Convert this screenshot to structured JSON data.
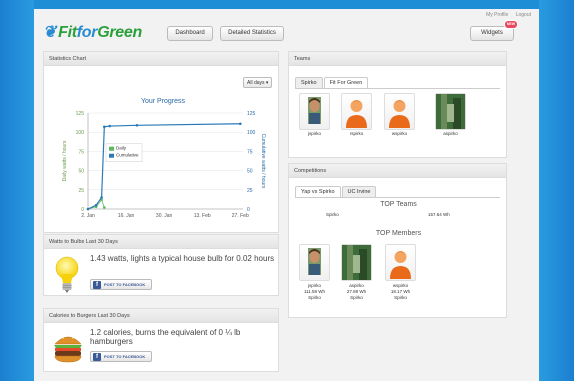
{
  "header": {
    "my_profile": "My Profile",
    "logout": "Logout",
    "logo_fit": "Fit",
    "logo_for": "for",
    "logo_green": "Green",
    "dashboard": "Dashboard",
    "detailed_statistics": "Detailed Statistics",
    "widgets": "Widgets",
    "widgets_badge": "NEW"
  },
  "stats_chart": {
    "panel_title": "Statistics Chart",
    "dropdown": "All days",
    "chart_title": "Your Progress"
  },
  "chart_data": {
    "type": "line",
    "title": "Your Progress",
    "ylabel": "Daily watts / hours",
    "ylabel_right": "Cumulative watts / hours",
    "ylim": [
      0,
      125
    ],
    "x_ticks": [
      "2. Jan",
      "16. Jan",
      "30. Jan",
      "13. Feb",
      "27. Feb"
    ],
    "y_ticks": [
      0,
      25,
      50,
      75,
      100,
      125
    ],
    "legend_position": "center-left",
    "series": [
      {
        "name": "Daily",
        "x": [
          "2. Jan",
          "5. Jan",
          "7. Jan",
          "8. Jan"
        ],
        "values": [
          0,
          3,
          12,
          2
        ],
        "color": "#5cb85c"
      },
      {
        "name": "Cumulative",
        "x": [
          "2. Jan",
          "5. Jan",
          "7. Jan",
          "8. Jan",
          "10. Jan",
          "20. Jan",
          "27. Feb"
        ],
        "values": [
          0,
          5,
          15,
          107,
          108,
          109,
          111
        ],
        "color": "#2a7ab8"
      }
    ]
  },
  "watts": {
    "panel_title": "Watts to Bulbs Last 30 Days",
    "text": "1.43 watts, lights a typical house bulb for 0.02 hours",
    "fb": "POST TO FACEBOOK"
  },
  "calories": {
    "panel_title": "Calories to Burgers Last 30 Days",
    "text": "1.2 calories, burns the equivalent of 0 ¼ lb hamburgers",
    "fb": "POST TO FACEBOOK"
  },
  "teams": {
    "panel_title": "Teams",
    "tabs": [
      "Spirko",
      "Fit For Green"
    ],
    "members": [
      "jspirko",
      "rspirko",
      "wspirko",
      "aspirko"
    ]
  },
  "competitions": {
    "panel_title": "Competitions",
    "tabs": [
      "Yap vs Spirko",
      "UC Irvine"
    ],
    "top_teams_title": "TOP Teams",
    "top_team_name": "Spirko",
    "top_team_value": "157.64 Wh",
    "top_members_title": "TOP Members",
    "members": [
      {
        "name": "jspirko",
        "value": "111.59 Wh",
        "team": "Spirko"
      },
      {
        "name": "aspirko",
        "value": "27.88 Wh",
        "team": "Spirko"
      },
      {
        "name": "wspirko",
        "value": "18.17 Wh",
        "team": "Spirko"
      }
    ]
  }
}
